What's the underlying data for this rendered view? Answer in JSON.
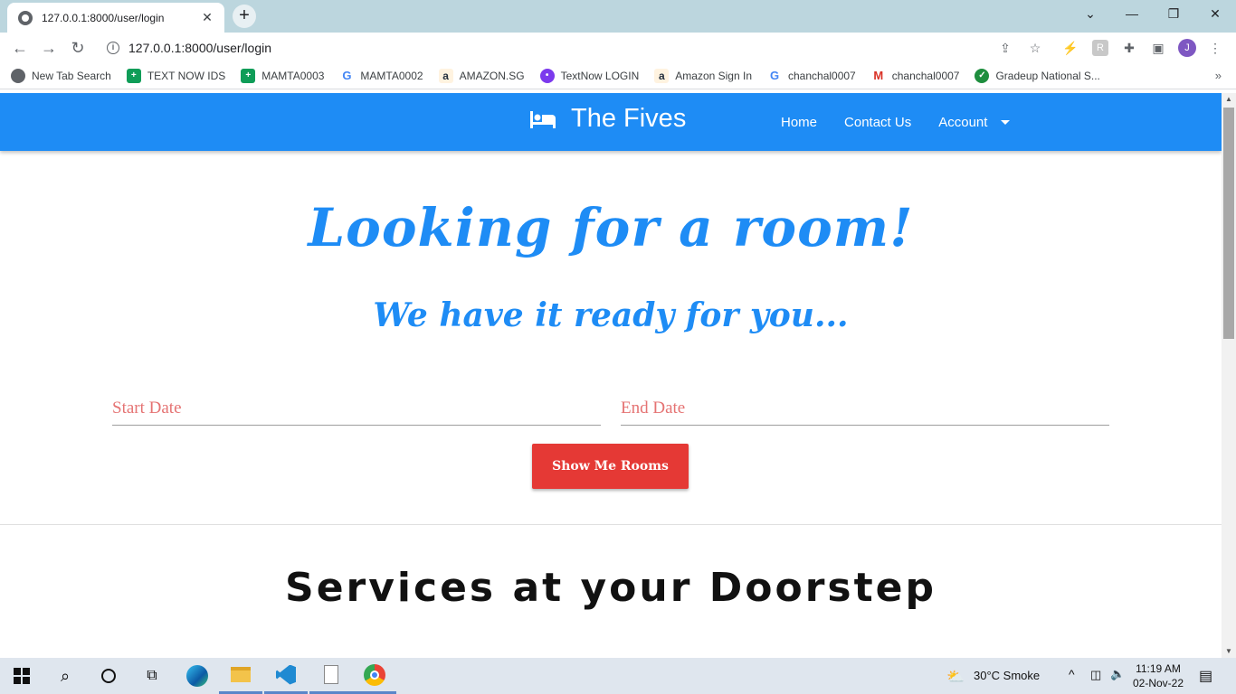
{
  "browser": {
    "tab_title": "127.0.0.1:8000/user/login",
    "url": "127.0.0.1:8000/user/login",
    "profile_initial": "J",
    "bookmarks": [
      {
        "label": "New Tab Search",
        "icon": "globe-icon",
        "color": "#5f6368"
      },
      {
        "label": "TEXT NOW IDS",
        "icon": "sheets-icon",
        "color": "#0f9d58"
      },
      {
        "label": "MAMTA0003",
        "icon": "sheets-icon",
        "color": "#0f9d58"
      },
      {
        "label": "MAMTA0002",
        "icon": "google-icon",
        "color": "#4285f4"
      },
      {
        "label": "AMAZON.SG",
        "icon": "amazon-icon",
        "color": "#232f3e"
      },
      {
        "label": "TextNow LOGIN",
        "icon": "textnow-icon",
        "color": "#7c3aed"
      },
      {
        "label": "Amazon Sign In",
        "icon": "amazon-icon",
        "color": "#232f3e"
      },
      {
        "label": "chanchal0007",
        "icon": "google-icon",
        "color": "#4285f4"
      },
      {
        "label": "chanchal0007",
        "icon": "gmail-icon",
        "color": "#d93025"
      },
      {
        "label": "Gradeup National S...",
        "icon": "gradeup-icon",
        "color": "#1e8e3e"
      }
    ]
  },
  "site": {
    "brand": "The Fives",
    "nav": {
      "home": "Home",
      "contact": "Contact Us",
      "account": "Account"
    },
    "hero_title": "Looking for a room!",
    "hero_subtitle": "We have it ready for you...",
    "start_placeholder": "Start Date",
    "end_placeholder": "End Date",
    "show_button": "Show Me Rooms",
    "services_title": "Services at your Doorstep",
    "colors": {
      "primary": "#1e8cf5",
      "accent": "#e53935"
    }
  },
  "taskbar": {
    "weather": "30°C  Smoke",
    "time": "11:19 AM",
    "date": "02-Nov-22"
  }
}
